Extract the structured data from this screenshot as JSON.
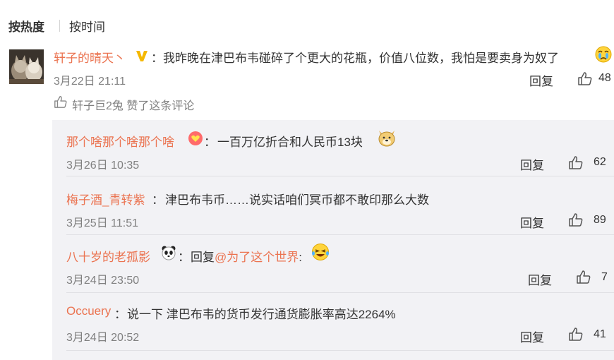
{
  "tabs": {
    "hot": "按热度",
    "time": "按时间"
  },
  "main_comment": {
    "username": "轩子的晴天丶",
    "colon": "：",
    "text": "我昨晚在津巴布韦碰碎了个更大的花瓶，价值八位数，我怕是要卖身为奴了",
    "time": "3月22日 21:11",
    "reply_label": "回复",
    "like_count": "48",
    "liked_by": "轩子巨2兔 赞了这条评论"
  },
  "replies": [
    {
      "username": "那个啥那个啥那个啥",
      "colon": "：",
      "text": "一百万亿折合和人民币13块",
      "time": "3月26日 10:35",
      "reply_label": "回复",
      "like_count": "62"
    },
    {
      "username": "梅子酒_青转紫",
      "colon": "：",
      "text": "津巴布韦币……说实话咱们冥币都不敢印那么大数",
      "time": "3月25日 11:51",
      "reply_label": "回复",
      "like_count": "89"
    },
    {
      "username": "八十岁的老孤影",
      "colon": "：",
      "text_prefix": "回复",
      "mention": "@为了这个世界",
      "text_suffix": ":",
      "time": "3月24日 23:50",
      "reply_label": "回复",
      "like_count": "7"
    },
    {
      "username": "Occuery",
      "colon": "：",
      "text": "说一下 津巴布韦的货币发行通货膨胀率高达2264%",
      "time": "3月24日 20:52",
      "reply_label": "回复",
      "like_count": "41"
    }
  ],
  "colors": {
    "username": "#eb7350",
    "text": "#333333",
    "meta": "#808080",
    "reply_bg": "#f2f2f5",
    "vip_badge": "#f5b800"
  }
}
